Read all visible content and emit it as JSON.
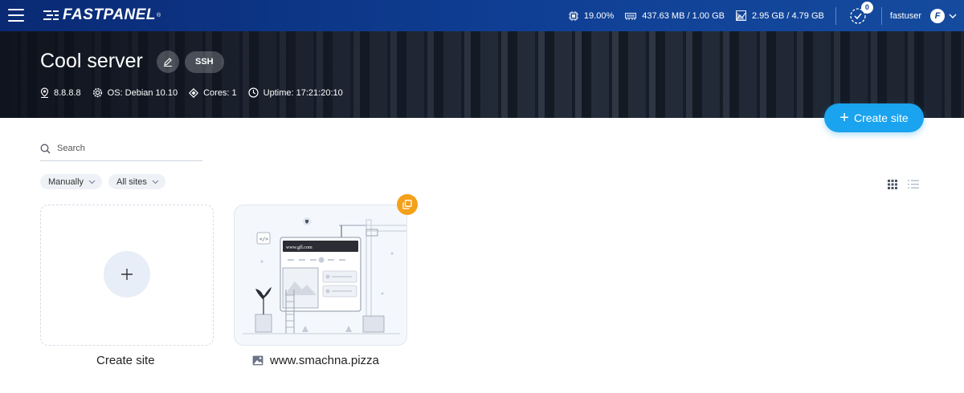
{
  "topbar": {
    "logo": "FASTPANEL",
    "logo_mark": "®",
    "cpu": "19.00%",
    "ram": "437.63 MB / 1.00 GB",
    "disk": "2.95 GB / 4.79 GB",
    "tasks_count": "0",
    "username": "fastuser",
    "avatar_letter": "F"
  },
  "server": {
    "title": "Cool server",
    "ssh_label": "SSH",
    "ip": "8.8.8.8",
    "os": "OS: Debian 10.10",
    "cores": "Cores: 1",
    "uptime": "Uptime: 17:21:20:10"
  },
  "actions": {
    "create_site": "Create site"
  },
  "search": {
    "placeholder": "Search"
  },
  "filters": {
    "sort": "Manually",
    "scope": "All sites"
  },
  "cards": {
    "new_label": "Create site",
    "sites": [
      {
        "name": "www.smachna.pizza",
        "preview_url": "www.gfl.com"
      }
    ]
  },
  "colors": {
    "topbar": "#0f3f95",
    "accent": "#1aa3ee",
    "copy_badge": "#f5a01a"
  }
}
